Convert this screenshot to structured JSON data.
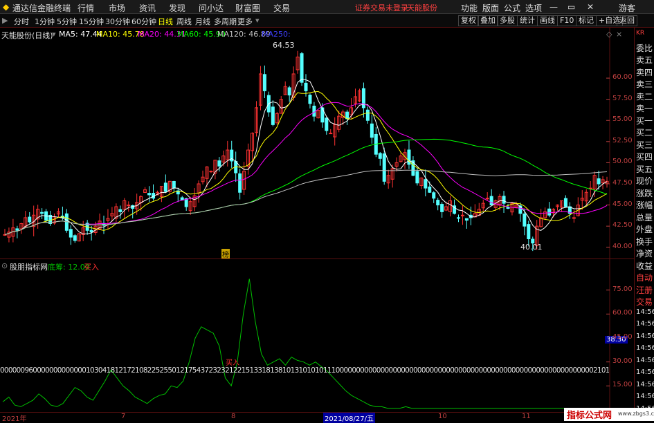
{
  "titlebar": {
    "app": "通达信金融终端",
    "menu": [
      "行情",
      "市场",
      "资讯",
      "发现",
      "问小达",
      "财富圈",
      "交易"
    ],
    "notice": "证券交易未登录",
    "stock_link": "天能股份",
    "right": [
      "功能",
      "版面",
      "公式",
      "选项"
    ],
    "user": "游客"
  },
  "toolbar": {
    "periods": [
      "分时",
      "1分钟",
      "5分钟",
      "15分钟",
      "30分钟",
      "60分钟",
      "日线",
      "周线",
      "月线",
      "多周期",
      "更多"
    ],
    "active": "日线",
    "buttons": [
      "复权",
      "叠加",
      "多股",
      "统计",
      "画线",
      "F10",
      "标记",
      "+自选",
      "返回"
    ]
  },
  "main": {
    "stock": "天能股份(日线)",
    "ma": [
      {
        "label": "MA5: 47.44",
        "color": "#ffffff"
      },
      {
        "label": "MA10: 45.78",
        "color": "#ffff00"
      },
      {
        "label": "MA20: 44.31",
        "color": "#ff00ff"
      },
      {
        "label": "MA60: 45.90",
        "color": "#00ff00"
      },
      {
        "label": "MA120: 46.89",
        "color": "#c0c0c0"
      },
      {
        "label": "MA250:",
        "color": "#4040ff"
      }
    ],
    "high_label": "64.53",
    "low_label": "40.01",
    "marker": "榜",
    "yticks": [
      "60.00",
      "57.50",
      "55.00",
      "52.50",
      "50.00",
      "47.50",
      "45.00",
      "42.50",
      "40.00"
    ]
  },
  "indicator": {
    "name": "股朋指标网",
    "line": "底筹: 12.00",
    "buy_label": "买入",
    "yticks": [
      "75.00",
      "60.00",
      "45.00",
      "30.00",
      "15.00"
    ],
    "current": "38.30",
    "digits": "00000096000000000000010304181217210822525501217543723232122151331813810131010101110000000000000000000000000000000000000000000000000000000000000002101181",
    "buy_marker": "买入",
    "colors": {
      "line": "#00c000",
      "text": "#e0e0e0",
      "buy": "#ff3030"
    }
  },
  "side": {
    "labels": [
      "KR",
      "委比",
      "卖五",
      "卖四",
      "卖三",
      "卖二",
      "卖一",
      "买一",
      "买二",
      "买三",
      "买四",
      "买五",
      "现价",
      "涨跌",
      "涨幅",
      "总量",
      "外盘",
      "换手",
      "净资",
      "收益",
      "自动",
      "汪册",
      "交易",
      "14:56",
      "14:56",
      "14:56",
      "14:56",
      "14:56",
      "14:56",
      "14:56",
      "14:56",
      "14:56"
    ]
  },
  "dates": [
    "2021年",
    "7",
    "8",
    "2021/08/27/五",
    "10",
    "11"
  ],
  "watermark": {
    "title": "指标公式网",
    "url": "www.zbgs3.com"
  },
  "chart_data": {
    "type": "candlestick",
    "price_range": [
      39,
      64.5
    ],
    "closes": [
      41.5,
      41.8,
      42.3,
      42.0,
      42.8,
      43.5,
      43.0,
      43.8,
      44.5,
      44.0,
      43.2,
      42.8,
      43.6,
      44.2,
      43.5,
      42.0,
      41.2,
      40.8,
      41.6,
      42.3,
      42.0,
      41.8,
      42.5,
      43.1,
      42.6,
      43.4,
      44.0,
      44.8,
      44.2,
      45.5,
      45.0,
      44.6,
      45.3,
      46.0,
      46.8,
      46.2,
      45.8,
      46.5,
      47.2,
      46.6,
      47.8,
      47.0,
      46.3,
      45.6,
      44.8,
      45.4,
      46.1,
      47.5,
      48.3,
      49.5,
      49.0,
      50.3,
      49.6,
      50.8,
      51.5,
      50.2,
      48.8,
      46.5,
      49.0,
      51.5,
      53.5,
      56.5,
      60.5,
      58.5,
      56.0,
      54.5,
      55.8,
      57.5,
      59.0,
      58.0,
      60.5,
      62.5,
      59.5,
      58.5,
      57.0,
      55.5,
      56.2,
      54.8,
      53.8,
      53.5,
      54.5,
      55.5,
      56.0,
      55.2,
      56.5,
      57.8,
      58.5,
      56.5,
      55.0,
      53.0,
      51.0,
      50.5,
      47.8,
      48.5,
      49.3,
      50.0,
      50.8,
      51.2,
      49.8,
      48.5,
      47.6,
      48.2,
      47.0,
      46.5,
      45.8,
      45.0,
      44.2,
      44.8,
      45.5,
      44.0,
      43.5,
      43.8,
      43.2,
      43.5,
      44.0,
      44.5,
      45.2,
      45.8,
      45.0,
      45.5,
      46.0,
      45.2,
      44.6,
      45.2,
      45.0,
      44.0,
      42.5,
      41.0,
      40.5,
      42.5,
      43.5,
      44.2,
      43.8,
      44.5,
      45.0,
      45.5,
      44.8,
      44.0,
      43.5,
      45.0,
      45.8,
      46.5,
      47.0,
      48.5,
      47.5,
      48.0,
      47.8
    ],
    "indicator_values": [
      5,
      8,
      3,
      2,
      4,
      6,
      10,
      7,
      3,
      2,
      4,
      9,
      14,
      12,
      8,
      6,
      12,
      18,
      25,
      20,
      15,
      12,
      8,
      6,
      4,
      7,
      9,
      10,
      15,
      14,
      18,
      30,
      45,
      52,
      50,
      48,
      40,
      20,
      15,
      30,
      60,
      82,
      55,
      35,
      28,
      30,
      32,
      28,
      33,
      31,
      30,
      28,
      30,
      27,
      24,
      20,
      16,
      12,
      9,
      7,
      5,
      3,
      2,
      2,
      1,
      1,
      1,
      2,
      1,
      1,
      1,
      1,
      1,
      1,
      1,
      1,
      1,
      1,
      1,
      1,
      1,
      1,
      1,
      1,
      1,
      1,
      1,
      1,
      1,
      1,
      1,
      1,
      1,
      1,
      1,
      1
    ]
  }
}
